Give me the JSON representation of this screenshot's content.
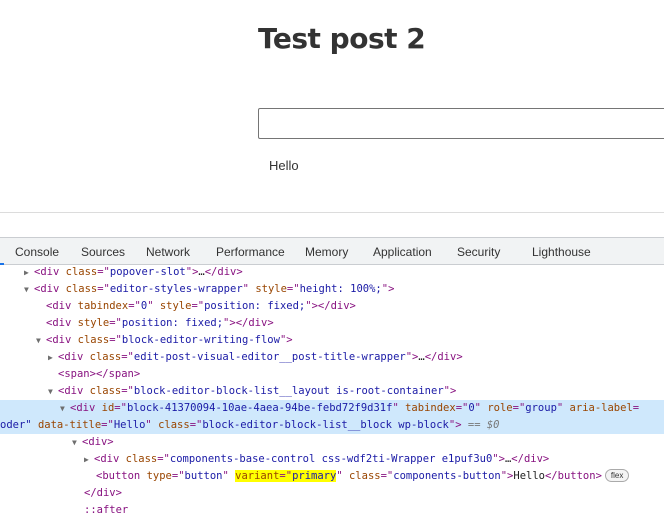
{
  "editor": {
    "post_title": "Test post 2",
    "control_input_value": "",
    "button_label": "Hello"
  },
  "devtools": {
    "tabs": [
      {
        "label": "Console"
      },
      {
        "label": "Sources"
      },
      {
        "label": "Network"
      },
      {
        "label": "Performance"
      },
      {
        "label": "Memory"
      },
      {
        "label": "Application"
      },
      {
        "label": "Security"
      },
      {
        "label": "Lighthouse"
      }
    ],
    "accent_color": "#1a73e8",
    "selected_row_color": "#cfe8fc",
    "dom": {
      "l1": {
        "tag": "div",
        "attr": "class",
        "val": "popover-slot",
        "collapsed": "…"
      },
      "l2": {
        "tag": "div",
        "attr1": "class",
        "val1": "editor-styles-wrapper",
        "attr2": "style",
        "val2": "height: 100%;"
      },
      "l3": {
        "tag": "div",
        "attr1": "tabindex",
        "val1": "0",
        "attr2": "style",
        "val2": "position: fixed;"
      },
      "l4": {
        "tag": "div",
        "attr": "style",
        "val": "position: fixed;"
      },
      "l5": {
        "tag": "div",
        "attr": "class",
        "val": "block-editor-writing-flow"
      },
      "l6": {
        "tag": "div",
        "attr": "class",
        "val": "edit-post-visual-editor__post-title-wrapper",
        "collapsed": "…"
      },
      "l7": {
        "tag": "span"
      },
      "l8": {
        "tag": "div",
        "attr": "class",
        "val": "block-editor-block-list__layout is-root-container"
      },
      "l9": {
        "tag": "div",
        "attr1": "id",
        "val1": "block-41370094-10ae-4aea-94be-febd72f9d31f",
        "attr2": "tabindex",
        "val2": "0",
        "attr3": "role",
        "val3": "group",
        "attr4": "aria-label"
      },
      "l10": {
        "prefix": "oder\"",
        "attr1": "data-title",
        "val1": "Hello",
        "attr2": "class",
        "val2": "block-editor-block-list__block wp-block",
        "eq": "==",
        "ref": "$0"
      },
      "l11": {
        "tag": "div"
      },
      "l12": {
        "tag": "div",
        "attr": "class",
        "val": "components-base-control css-wdf2ti-Wrapper e1puf3u0",
        "collapsed": "…"
      },
      "l13": {
        "tag": "button",
        "attr1": "type",
        "val1": "button",
        "attr2": "variant",
        "val2": "primary",
        "attr3": "class",
        "val3": "components-button",
        "text": "Hello",
        "badge": "flex"
      },
      "l14": {
        "tag": "div"
      },
      "l15": {
        "pseudo": "::after"
      }
    }
  }
}
